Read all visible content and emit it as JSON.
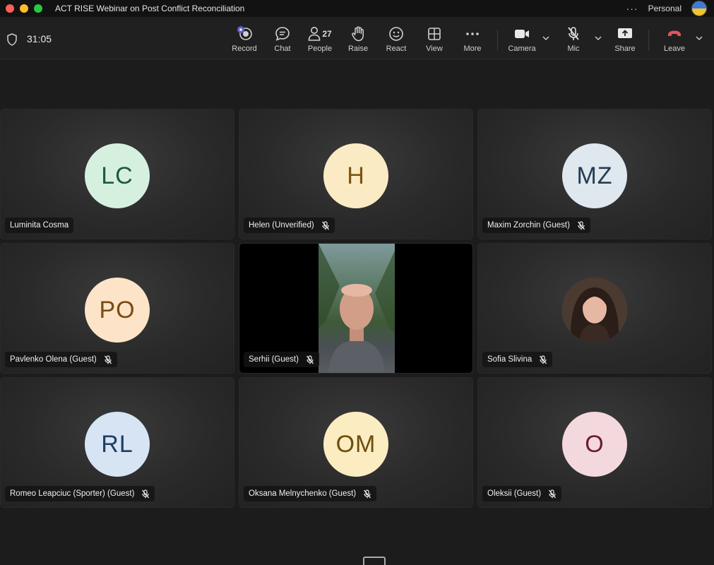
{
  "window": {
    "title": "ACT RISE Webinar on Post Conflict Reconciliation",
    "account": "Personal"
  },
  "toolbar": {
    "timer": "31:05",
    "record": "Record",
    "chat": "Chat",
    "people": "People",
    "people_count": "27",
    "raise": "Raise",
    "react": "React",
    "view": "View",
    "more": "More",
    "camera": "Camera",
    "mic": "Mic",
    "share": "Share",
    "leave": "Leave"
  },
  "participants": [
    {
      "initials": "LC",
      "name": "Luminita Cosma",
      "muted": false,
      "bg": "#d6f0df",
      "fg": "#1f5a3a"
    },
    {
      "initials": "H",
      "name": "Helen (Unverified)",
      "muted": true,
      "bg": "#fbebc4",
      "fg": "#7a5610"
    },
    {
      "initials": "MZ",
      "name": "Maxim Zorchin (Guest)",
      "muted": true,
      "bg": "#dfe7ef",
      "fg": "#243c52"
    },
    {
      "initials": "PO",
      "name": "Pavlenko Olena (Guest)",
      "muted": true,
      "bg": "#fde4c8",
      "fg": "#7a4a12"
    },
    {
      "initials": "",
      "name": "Serhii (Guest)",
      "muted": true,
      "video": true
    },
    {
      "initials": "",
      "name": "Sofia Slivina",
      "muted": true,
      "photo": true
    },
    {
      "initials": "RL",
      "name": "Romeo Leapciuc (Sporter) (Guest)",
      "muted": true,
      "bg": "#d6e4f4",
      "fg": "#1f3e66"
    },
    {
      "initials": "OM",
      "name": "Oksana Melnychenko (Guest)",
      "muted": true,
      "bg": "#fbecc2",
      "fg": "#6e4e0c"
    },
    {
      "initials": "O",
      "name": "Oleksii (Guest)",
      "muted": true,
      "bg": "#f3d9dd",
      "fg": "#6a1e2c"
    }
  ],
  "colors": {
    "leave": "#e0575c",
    "record_badge": "#5b5fc7"
  }
}
